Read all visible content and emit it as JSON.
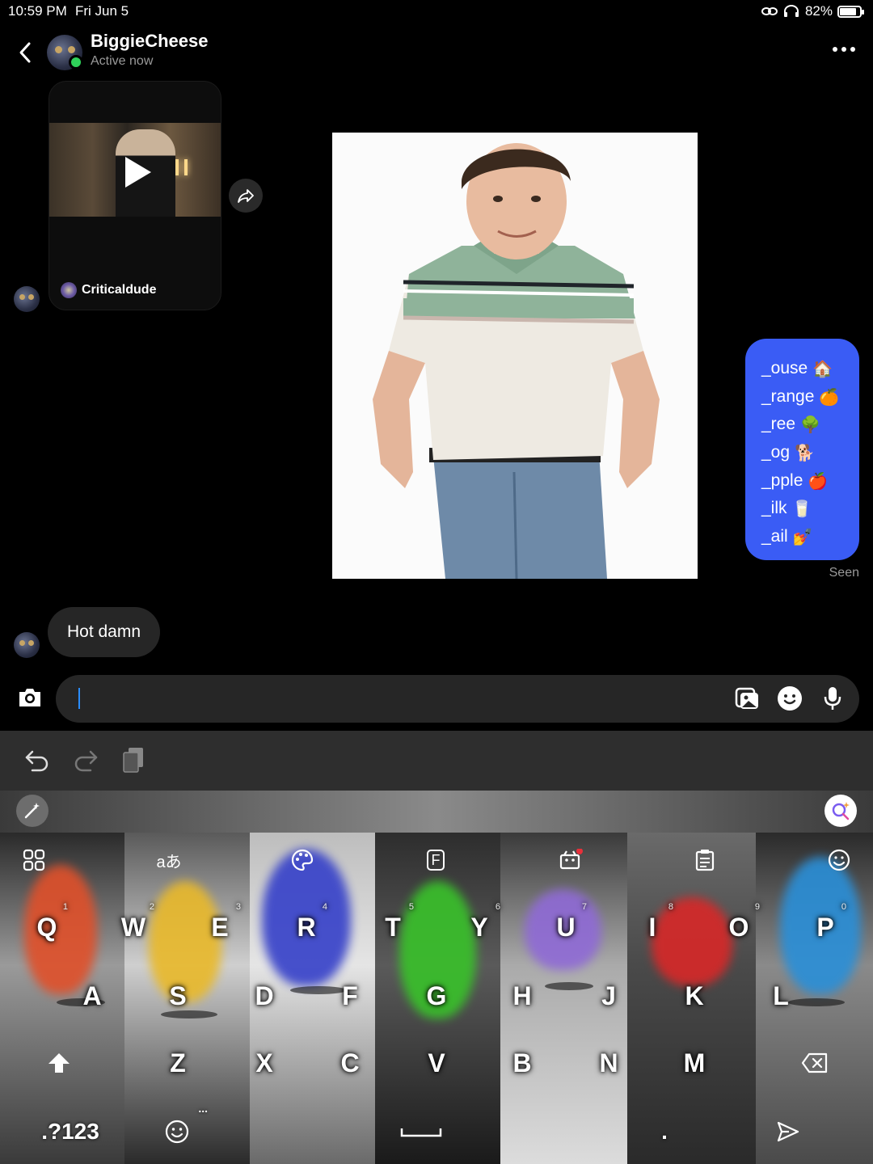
{
  "status_bar": {
    "time": "10:59 PM",
    "date": "Fri Jun 5",
    "battery": "82%",
    "battery_level": 0.82
  },
  "header": {
    "name": "BiggieCheese",
    "status": "Active now"
  },
  "shared_video": {
    "author": "Criticaldude"
  },
  "blue_message": {
    "lines": [
      {
        "text": "_ouse",
        "emoji": "🏠"
      },
      {
        "text": "_range",
        "emoji": "🍊"
      },
      {
        "text": "_ree",
        "emoji": "🌳"
      },
      {
        "text": "_og",
        "emoji": "🐕"
      },
      {
        "text": "_pple",
        "emoji": "🍎"
      },
      {
        "text": "_ilk",
        "emoji": "🥛"
      },
      {
        "text": "_ail",
        "emoji": "💅"
      }
    ],
    "receipt": "Seen",
    "color": "#3a5cf5"
  },
  "reply_message": {
    "text": "Hot damn"
  },
  "composer": {
    "placeholder": ""
  },
  "keyboard": {
    "row1": [
      {
        "key": "Q",
        "num": "1"
      },
      {
        "key": "W",
        "num": "2"
      },
      {
        "key": "E",
        "num": "3"
      },
      {
        "key": "R",
        "num": "4"
      },
      {
        "key": "T",
        "num": "5"
      },
      {
        "key": "Y",
        "num": "6"
      },
      {
        "key": "U",
        "num": "7"
      },
      {
        "key": "I",
        "num": "8"
      },
      {
        "key": "O",
        "num": "9"
      },
      {
        "key": "P",
        "num": "0"
      }
    ],
    "row2": [
      "A",
      "S",
      "D",
      "F",
      "G",
      "H",
      "J",
      "K",
      "L"
    ],
    "row3": [
      "Z",
      "X",
      "C",
      "V",
      "B",
      "N",
      "M"
    ],
    "symbols_key": ".?123",
    "period_key": ".",
    "more_key": "...",
    "translate_glyph": "aあ",
    "font_glyph": "F"
  }
}
